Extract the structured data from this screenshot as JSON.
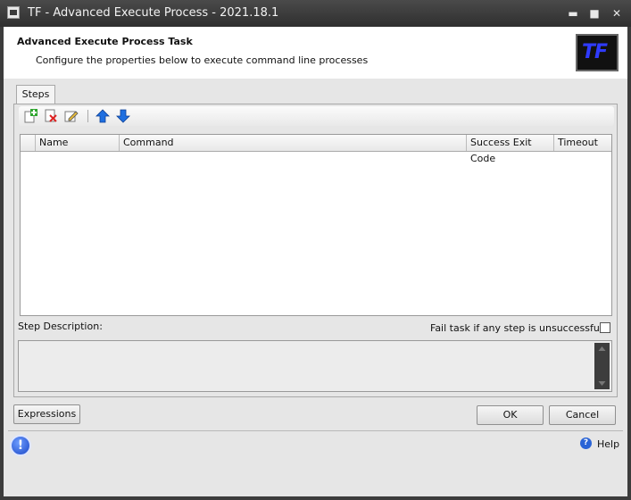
{
  "window": {
    "title": "TF - Advanced Execute Process - 2021.18.1",
    "minimize": "▬",
    "maximize": "■",
    "close": "✕"
  },
  "header": {
    "title": "Advanced Execute Process Task",
    "subtitle": "Configure the properties below to execute command line processes",
    "logo_text": "TF"
  },
  "tabs": [
    {
      "label": "Steps",
      "active": true
    }
  ],
  "toolbar": {
    "icons": [
      "add-step-icon",
      "delete-step-icon",
      "edit-step-icon",
      "move-up-icon",
      "move-down-icon"
    ]
  },
  "grid": {
    "columns": [
      "Name",
      "Command",
      "Success Exit Code",
      "Timeout"
    ],
    "rows": []
  },
  "step_description": {
    "label": "Step Description:",
    "value": ""
  },
  "fail_task": {
    "label": "Fail task if any step is unsuccessful",
    "checked": false
  },
  "buttons": {
    "expressions": "Expressions",
    "ok": "OK",
    "cancel": "Cancel"
  },
  "footer": {
    "help": "Help",
    "info_glyph": "!",
    "help_glyph": "?"
  },
  "colors": {
    "title_bar": "#3a3a3a",
    "content_bg": "#e6e6e6",
    "logo_text": "#2f3bff",
    "arrow_blue": "#1f6fe0"
  }
}
